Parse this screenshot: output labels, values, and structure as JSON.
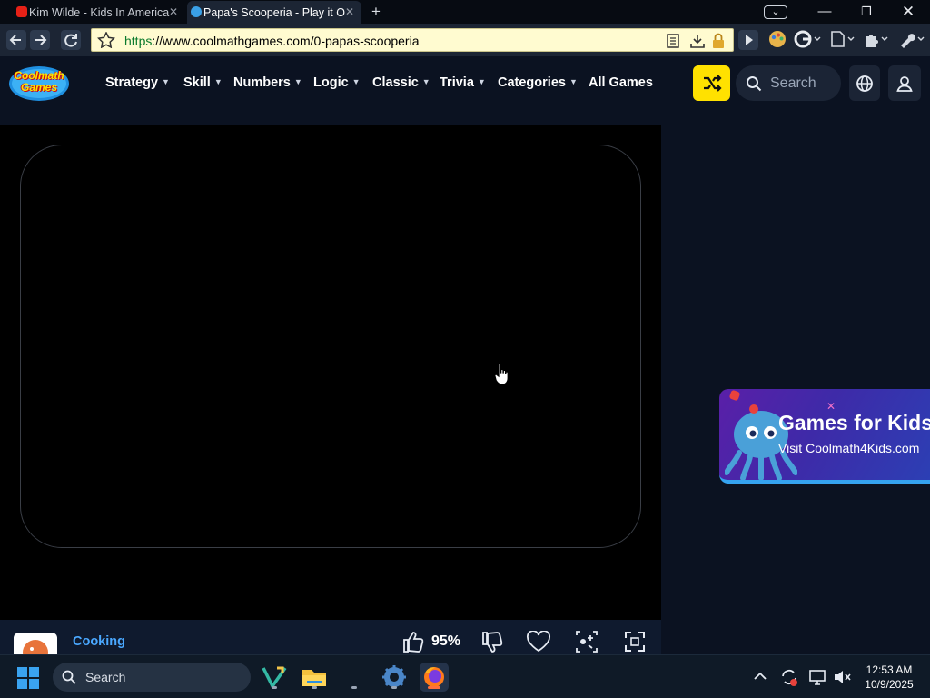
{
  "browser": {
    "tabs": [
      {
        "title": "Kim Wilde - Kids In America",
        "active": false
      },
      {
        "title": "Papa's Scooperia - Play it O",
        "active": true
      }
    ],
    "url": {
      "scheme": "https",
      "rest": "://www.coolmathgames.com/0-papas-scooperia"
    }
  },
  "site": {
    "logo": {
      "line1": "Coolmath",
      "line2": "Games"
    },
    "nav": [
      {
        "label": "Strategy",
        "dropdown": true
      },
      {
        "label": "Skill",
        "dropdown": true
      },
      {
        "label": "Numbers",
        "dropdown": true
      },
      {
        "label": "Logic",
        "dropdown": true
      },
      {
        "label": "Classic",
        "dropdown": true
      },
      {
        "label": "Trivia",
        "dropdown": true
      },
      {
        "label": "Categories",
        "dropdown": true
      },
      {
        "label": "All Games",
        "dropdown": false
      }
    ],
    "search_placeholder": "Search",
    "accent_color": "#ffe100"
  },
  "game_bar": {
    "category": "Cooking",
    "rating": "95%"
  },
  "ad": {
    "title": "Games for Kids",
    "subtitle": "Visit Coolmath4Kids.com"
  },
  "taskbar": {
    "search_label": "Search",
    "time": "12:53 AM",
    "date": "10/9/2025"
  }
}
